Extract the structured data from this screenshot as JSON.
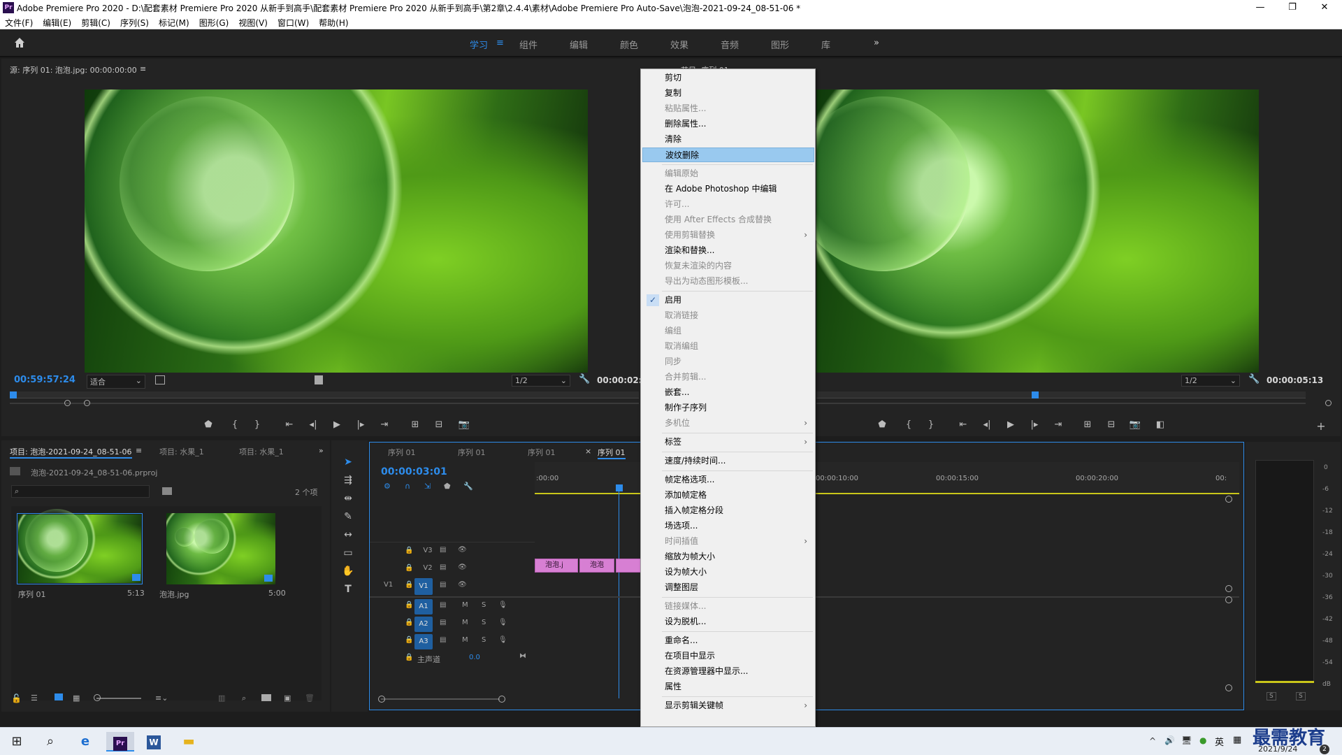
{
  "titlebar": {
    "icon": "Pr",
    "text": "Adobe Premiere Pro 2020 - D:\\配套素材 Premiere Pro 2020 从新手到高手\\配套素材 Premiere Pro 2020 从新手到高手\\第2章\\2.4.4\\素材\\Adobe Premiere Pro Auto-Save\\泡泡-2021-09-24_08-51-06 *",
    "minimize": "—",
    "maximize": "❐",
    "close": "✕"
  },
  "menu": [
    "文件(F)",
    "编辑(E)",
    "剪辑(C)",
    "序列(S)",
    "标记(M)",
    "图形(G)",
    "视图(V)",
    "窗口(W)",
    "帮助(H)"
  ],
  "workspaces": {
    "items": [
      "学习",
      "组件",
      "编辑",
      "颜色",
      "效果",
      "音频",
      "图形",
      "库"
    ],
    "active": "学习",
    "more": "»"
  },
  "source": {
    "title": "源: 序列 01: 泡泡.jpg: 00:00:00:00",
    "menu": "≡",
    "timecode": "00:59:57:24",
    "fit": "适合",
    "res": "1/2",
    "duration": "00:00:02:"
  },
  "program": {
    "title": "节目: 序列 01",
    "res": "1/2",
    "duration": "00:00:05:13"
  },
  "project": {
    "tabs": [
      "项目: 泡泡-2021-09-24_08-51-06",
      "项目: 水果_1",
      "项目: 水果_1"
    ],
    "menu": "≡",
    "more": "»",
    "file": "泡泡-2021-09-24_08-51-06.prproj",
    "count": "2 个项",
    "search_placeholder": "",
    "items": [
      {
        "name": "序列 01",
        "dur": "5:13"
      },
      {
        "name": "泡泡.jpg",
        "dur": "5:00"
      }
    ]
  },
  "timeline": {
    "tabs": [
      "序列 01",
      "序列 01",
      "序列 01",
      "序列 01"
    ],
    "active_tab": "序列 01",
    "close": "×",
    "timecode": "00:00:03:01",
    "ruler": [
      ":00:00",
      "00:00:10:00",
      "00:00:15:00",
      "00:00:20:00",
      "00:"
    ],
    "video_tracks": [
      {
        "name": "V3"
      },
      {
        "name": "V2"
      },
      {
        "name": "V1",
        "src": "V1"
      }
    ],
    "audio_tracks": [
      {
        "name": "A1"
      },
      {
        "name": "A2"
      },
      {
        "name": "A3"
      }
    ],
    "master": "主声道",
    "master_val": "0.0",
    "clips": [
      "泡泡.j",
      "泡泡",
      ""
    ],
    "m": "M",
    "s": "S"
  },
  "meter": {
    "labels": [
      "0",
      "-6",
      "-12",
      "-18",
      "-24",
      "-30",
      "-36",
      "-42",
      "-48",
      "-54",
      "dB"
    ],
    "solo": [
      "S",
      "S"
    ]
  },
  "context_menu": {
    "items": [
      {
        "label": "剪切",
        "state": "enabled"
      },
      {
        "label": "复制",
        "state": "enabled"
      },
      {
        "label": "粘贴属性...",
        "state": "disabled"
      },
      {
        "label": "删除属性...",
        "state": "enabled"
      },
      {
        "label": "清除",
        "state": "enabled"
      },
      {
        "label": "波纹删除",
        "state": "highlighted"
      },
      {
        "sep": true
      },
      {
        "label": "编辑原始",
        "state": "disabled"
      },
      {
        "label": "在 Adobe Photoshop 中编辑",
        "state": "enabled"
      },
      {
        "label": "许可...",
        "state": "disabled"
      },
      {
        "label": "使用 After Effects 合成替换",
        "state": "disabled"
      },
      {
        "label": "使用剪辑替换",
        "state": "disabled",
        "submenu": true
      },
      {
        "label": "渲染和替换...",
        "state": "enabled"
      },
      {
        "label": "恢复未渲染的内容",
        "state": "disabled"
      },
      {
        "label": "导出为动态图形模板...",
        "state": "disabled"
      },
      {
        "sep": true
      },
      {
        "label": "启用",
        "state": "enabled",
        "checked": true
      },
      {
        "label": "取消链接",
        "state": "disabled"
      },
      {
        "label": "编组",
        "state": "disabled"
      },
      {
        "label": "取消编组",
        "state": "disabled"
      },
      {
        "label": "同步",
        "state": "disabled"
      },
      {
        "label": "合并剪辑...",
        "state": "disabled"
      },
      {
        "label": "嵌套...",
        "state": "enabled"
      },
      {
        "label": "制作子序列",
        "state": "enabled"
      },
      {
        "label": "多机位",
        "state": "disabled",
        "submenu": true
      },
      {
        "sep": true
      },
      {
        "label": "标签",
        "state": "enabled",
        "submenu": true
      },
      {
        "sep": true
      },
      {
        "label": "速度/持续时间...",
        "state": "enabled"
      },
      {
        "sep": true
      },
      {
        "label": "帧定格选项...",
        "state": "enabled"
      },
      {
        "label": "添加帧定格",
        "state": "enabled"
      },
      {
        "label": "插入帧定格分段",
        "state": "enabled"
      },
      {
        "label": "场选项...",
        "state": "enabled"
      },
      {
        "label": "时间插值",
        "state": "disabled",
        "submenu": true
      },
      {
        "label": "缩放为帧大小",
        "state": "enabled"
      },
      {
        "label": "设为帧大小",
        "state": "enabled"
      },
      {
        "label": "调整图层",
        "state": "enabled"
      },
      {
        "sep": true
      },
      {
        "label": "链接媒体...",
        "state": "disabled"
      },
      {
        "label": "设为脱机...",
        "state": "enabled"
      },
      {
        "sep": true
      },
      {
        "label": "重命名...",
        "state": "enabled"
      },
      {
        "label": "在项目中显示",
        "state": "enabled"
      },
      {
        "label": "在资源管理器中显示...",
        "state": "enabled"
      },
      {
        "label": "属性",
        "state": "enabled"
      },
      {
        "sep": true
      },
      {
        "label": "显示剪辑关键帧",
        "state": "enabled",
        "submenu": true
      }
    ],
    "arrow": "›",
    "check": "✓"
  },
  "taskbar": {
    "ime": "英",
    "watermark": "最需教育",
    "date": "2021/9/24",
    "badge": "2"
  },
  "colors": {
    "accent": "#2d8ceb",
    "clip": "#d77fd3",
    "highlight": "#99c9ef"
  }
}
